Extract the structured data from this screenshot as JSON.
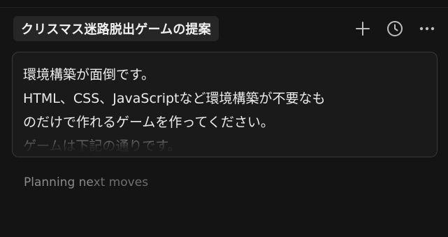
{
  "thread": {
    "title": "クリスマス迷路脱出ゲームの提案"
  },
  "actions": [
    {
      "name": "new-chat",
      "icon": "plus-icon"
    },
    {
      "name": "history",
      "icon": "clock-icon"
    },
    {
      "name": "more",
      "icon": "ellipsis-icon"
    }
  ],
  "message": {
    "lines": [
      "環境構築が面倒です。",
      "HTML、CSS、JavaScriptなど環境構築が不要なも",
      "のだけで作れるゲームを作ってください。",
      "ゲームは下記の通りです。"
    ]
  },
  "status": {
    "bright": "Planning ne",
    "dim": "xt moves"
  },
  "colors": {
    "background": "#141414",
    "card": "#1a1a1a",
    "chip": "#262626",
    "icon": "#bdbdbd"
  }
}
